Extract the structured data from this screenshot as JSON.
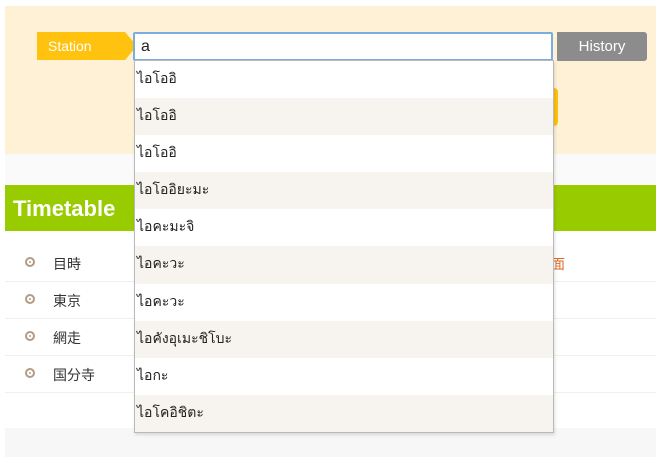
{
  "search": {
    "station_label": "Station",
    "input_value": "a",
    "history_label": "History"
  },
  "suggestions": [
    "ไอโออิ",
    "ไอโออิ",
    "ไอโออิ",
    "ไอโออิยะมะ",
    "ไอคะมะจิ",
    "ไอคะวะ",
    "ไอคะวะ",
    "ไอคังอุเมะชิโบะ",
    "ไอกะ",
    "ไอโคอิชิตะ"
  ],
  "timetable": {
    "title": "Timetable",
    "rows": [
      {
        "name": "目時",
        "extra": "面"
      },
      {
        "name": "東京",
        "extra": ""
      },
      {
        "name": "網走",
        "extra": ""
      },
      {
        "name": "国分寺",
        "extra": ""
      }
    ]
  },
  "colors": {
    "accent_yellow": "#ffc20e",
    "panel_bg": "#fff1d6",
    "timetable_green": "#99cc00",
    "history_gray": "#8c8c8c",
    "input_border": "#7aaee3"
  }
}
